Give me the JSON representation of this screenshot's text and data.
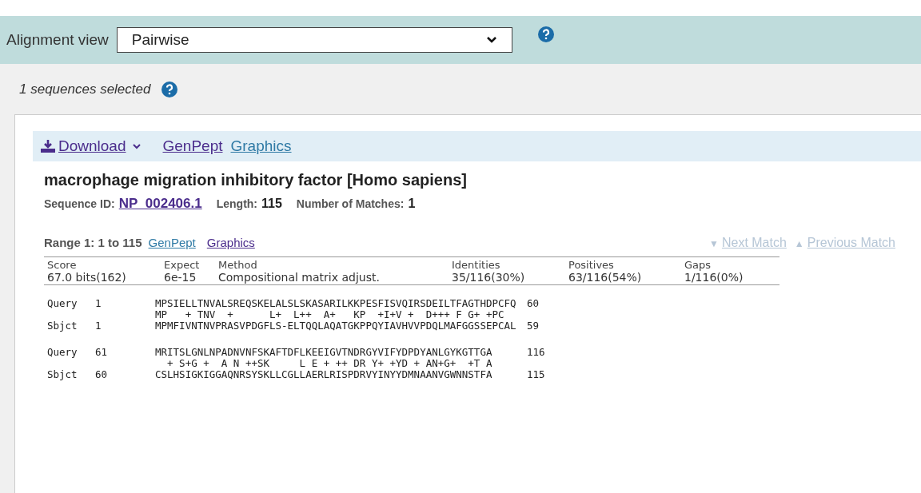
{
  "toolbar": {
    "label": "Alignment view",
    "select_value": "Pairwise"
  },
  "selection": {
    "text": "1 sequences selected"
  },
  "actions": {
    "download": "Download",
    "links": [
      "GenPept",
      "Graphics"
    ]
  },
  "hit": {
    "title": "macrophage migration inhibitory factor [Homo sapiens]",
    "meta": [
      {
        "label": "Sequence ID:",
        "value": "NP_002406.1",
        "kind": "link"
      },
      {
        "label": "Length:",
        "value": "115",
        "kind": "text"
      },
      {
        "label": "Number of Matches:",
        "value": "1",
        "kind": "text"
      }
    ]
  },
  "range": {
    "label": "Range 1: 1 to 115",
    "links": [
      "GenPept",
      "Graphics"
    ],
    "nav": [
      {
        "arrow": "▼",
        "label": "Next Match",
        "disabled": true
      },
      {
        "arrow": "▲",
        "label": "Previous Match",
        "disabled": true
      }
    ]
  },
  "score_table": {
    "columns": [
      "Score",
      "Expect",
      "Method",
      "Identities",
      "Positives",
      "Gaps"
    ],
    "values": [
      "67.0 bits(162)",
      "6e-15",
      "Compositional matrix adjust.",
      "35/116(30%)",
      "63/116(54%)",
      "1/116(0%)"
    ]
  },
  "alignment": [
    {
      "query": {
        "label": "Query",
        "start": "1",
        "seq": "MPSIELLTNVALSREQSKELALSLSKASARILKKPESFISVQIRSDEILTFAGTHDPCFQ",
        "end": "60"
      },
      "midline": "MP   + TNV  +      L+  L++  A+   KP  +I+V +  D+++ F G+ +PC",
      "sbjct": {
        "label": "Sbjct",
        "start": "1",
        "seq": "MPMFIVNTNVPRASVPDGFLS-ELTQQLAQATGKPPQYIAVHVVPDQLMAFGGSSEPCAL",
        "end": "59"
      }
    },
    {
      "query": {
        "label": "Query",
        "start": "61",
        "seq": "MRITSLGNLNPADNVNFSKAFTDFLKEEIGVTNDRGYVIFYDPDYANLGYKGTTGA",
        "end": "116"
      },
      "midline": "  + S+G +  A N ++SK     L E + ++ DR Y+ +YD + AN+G+  +T A",
      "sbjct": {
        "label": "Sbjct",
        "start": "60",
        "seq": "CSLHSIGKIGGAQNRSYSKLLCGLLAERLRISPDRVYINYYDMNAANVGWNNSTFA",
        "end": "115"
      }
    }
  ]
}
